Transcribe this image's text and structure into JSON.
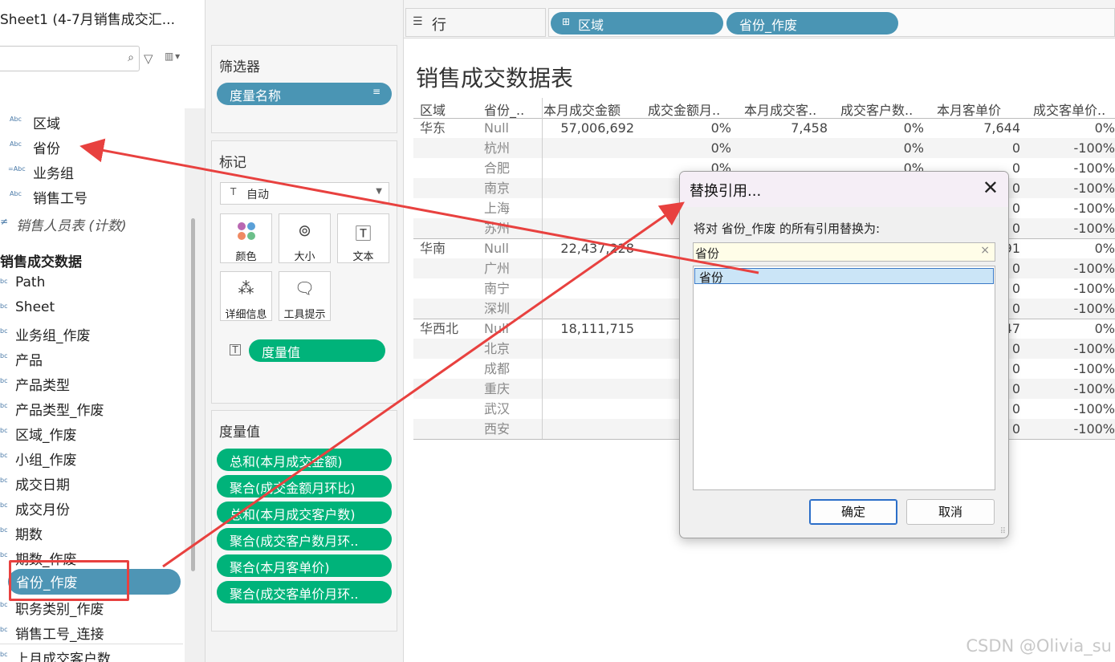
{
  "sheet_title": "Sheet1 (4-7月销售成交汇...",
  "data_pane": {
    "fields_top": [
      {
        "type": "Abc",
        "label": "区域"
      },
      {
        "type": "Abc",
        "label": "省份"
      },
      {
        "type": "=Abc",
        "label": "业务组"
      },
      {
        "type": "Abc",
        "label": "销售工号"
      }
    ],
    "staff_count": "销售人员表 (计数)",
    "section_header": "销售成交数据",
    "fields_bottom": [
      {
        "label": "Path"
      },
      {
        "label": "Sheet"
      },
      {
        "label": "业务组_作废"
      },
      {
        "label": "产品"
      },
      {
        "label": "产品类型"
      },
      {
        "label": "产品类型_作废"
      },
      {
        "label": "区域_作废"
      },
      {
        "label": "小组_作废"
      },
      {
        "label": "成交日期"
      },
      {
        "label": "成交月份"
      },
      {
        "label": "期数"
      },
      {
        "label": "期数_作废"
      },
      {
        "label": "省份_作废"
      },
      {
        "label": "职务类别_作废"
      },
      {
        "label": "销售工号_连接"
      },
      {
        "label": "上月成交客户数"
      }
    ]
  },
  "filters": {
    "title": "筛选器",
    "pill": "度量名称"
  },
  "marks": {
    "title": "标记",
    "mark_type": "自动",
    "buttons": [
      "颜色",
      "大小",
      "文本",
      "详细信息",
      "工具提示"
    ],
    "text_pill": "度量值"
  },
  "measure_values": {
    "title": "度量值",
    "pills": [
      "总和(本月成交金额)",
      "聚合(成交金额月环比)",
      "总和(本月成交客户数)",
      "聚合(成交客户数月环..",
      "聚合(本月客单价)",
      "聚合(成交客单价月环.."
    ]
  },
  "rows_shelf": {
    "label": "行",
    "pills": [
      "区域",
      "省份_作废"
    ]
  },
  "viz": {
    "title": "销售成交数据表",
    "headers": [
      "区域",
      "省份_..",
      "本月成交金额",
      "成交金额月..",
      "本月成交客..",
      "成交客户数..",
      "本月客单价",
      "成交客单价.."
    ],
    "rows": [
      {
        "region": "华东",
        "province": "Null",
        "v1": "57,006,692",
        "v2": "0%",
        "v3": "7,458",
        "v4": "0%",
        "v5": "7,644",
        "v6": "0%"
      },
      {
        "region": "",
        "province": "杭州",
        "v1": "",
        "v2": "0%",
        "v3": "",
        "v4": "0%",
        "v5": "0",
        "v6": "-100%"
      },
      {
        "region": "",
        "province": "合肥",
        "v1": "",
        "v2": "0%",
        "v3": "",
        "v4": "0%",
        "v5": "0",
        "v6": "-100%"
      },
      {
        "region": "",
        "province": "南京",
        "v1": "",
        "v2": "",
        "v3": "",
        "v4": "",
        "v5": "0",
        "v6": "-100%"
      },
      {
        "region": "",
        "province": "上海",
        "v1": "",
        "v2": "",
        "v3": "",
        "v4": "",
        "v5": "0",
        "v6": "-100%"
      },
      {
        "region": "",
        "province": "苏州",
        "v1": "",
        "v2": "",
        "v3": "",
        "v4": "",
        "v5": "0",
        "v6": "-100%"
      },
      {
        "region": "华南",
        "province": "Null",
        "v1": "22,437,228",
        "v2": "",
        "v3": "",
        "v4": "",
        "v5": "91",
        "v6": "0%"
      },
      {
        "region": "",
        "province": "广州",
        "v1": "",
        "v2": "",
        "v3": "",
        "v4": "",
        "v5": "0",
        "v6": "-100%"
      },
      {
        "region": "",
        "province": "南宁",
        "v1": "",
        "v2": "",
        "v3": "",
        "v4": "",
        "v5": "0",
        "v6": "-100%"
      },
      {
        "region": "",
        "province": "深圳",
        "v1": "",
        "v2": "",
        "v3": "",
        "v4": "",
        "v5": "0",
        "v6": "-100%"
      },
      {
        "region": "华西北",
        "province": "Null",
        "v1": "18,111,715",
        "v2": "",
        "v3": "",
        "v4": "",
        "v5": "47",
        "v6": "0%"
      },
      {
        "region": "",
        "province": "北京",
        "v1": "",
        "v2": "",
        "v3": "",
        "v4": "",
        "v5": "0",
        "v6": "-100%"
      },
      {
        "region": "",
        "province": "成都",
        "v1": "",
        "v2": "",
        "v3": "",
        "v4": "",
        "v5": "0",
        "v6": "-100%"
      },
      {
        "region": "",
        "province": "重庆",
        "v1": "",
        "v2": "",
        "v3": "",
        "v4": "",
        "v5": "0",
        "v6": "-100%"
      },
      {
        "region": "",
        "province": "武汉",
        "v1": "",
        "v2": "",
        "v3": "",
        "v4": "",
        "v5": "0",
        "v6": "-100%"
      },
      {
        "region": "",
        "province": "西安",
        "v1": "",
        "v2": "",
        "v3": "",
        "v4": "",
        "v5": "0",
        "v6": "-100%"
      }
    ]
  },
  "dialog": {
    "title": "替换引用...",
    "prompt": "将对 省份_作废 的所有引用替换为:",
    "input_value": "省份",
    "list_item": "省份",
    "ok_label": "确定",
    "cancel_label": "取消"
  },
  "watermark": "CSDN @Olivia_su",
  "colors": {
    "pill_blue": "#4a95b4",
    "pill_green": "#00b37a",
    "annotation_red": "#e8413f"
  }
}
